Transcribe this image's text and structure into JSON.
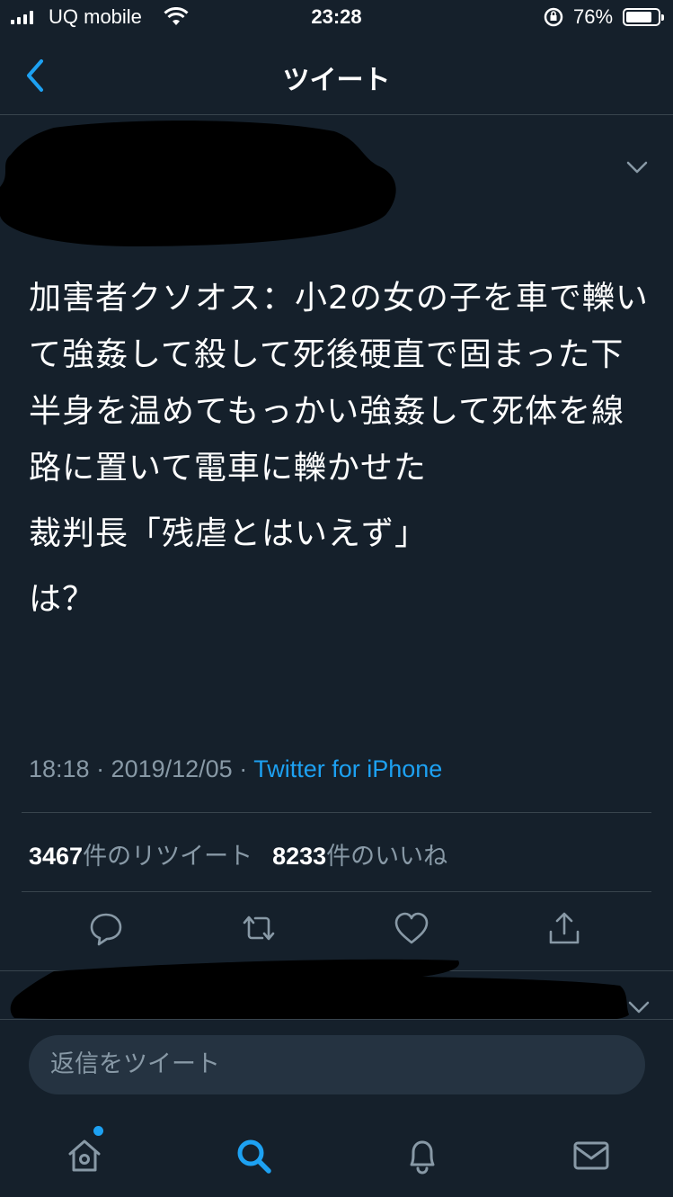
{
  "status_bar": {
    "carrier": "UQ mobile",
    "time": "23:28",
    "battery_percent": "76%"
  },
  "nav": {
    "title": "ツイート"
  },
  "tweet": {
    "body_paragraphs": [
      "加害者クソオス：小2の女の子を車で轢いて強姦して殺して死後硬直で固まった下半身を温めてもっかい強姦して死体を線路に置いて電車に轢かせた",
      "裁判長「残虐とはいえず」",
      "は？"
    ],
    "time_date": "18:18 · 2019/12/05 · ",
    "source": "Twitter for iPhone",
    "retweet_count": "3467",
    "retweet_label": "件のリツイート",
    "like_count": "8233",
    "like_label": "件のいいね"
  },
  "reply": {
    "placeholder": "返信をツイート"
  },
  "colors": {
    "background": "#15202b",
    "accent": "#1da1f2",
    "secondary_text": "#8899a6",
    "divider": "#38444d"
  },
  "icons": {
    "back": "chevron-left-icon",
    "more": "chevron-down-icon",
    "reply": "comment-icon",
    "retweet": "retweet-icon",
    "like": "heart-icon",
    "share": "share-icon",
    "home": "home-icon",
    "search": "search-icon",
    "notifications": "bell-icon",
    "messages": "envelope-icon"
  }
}
